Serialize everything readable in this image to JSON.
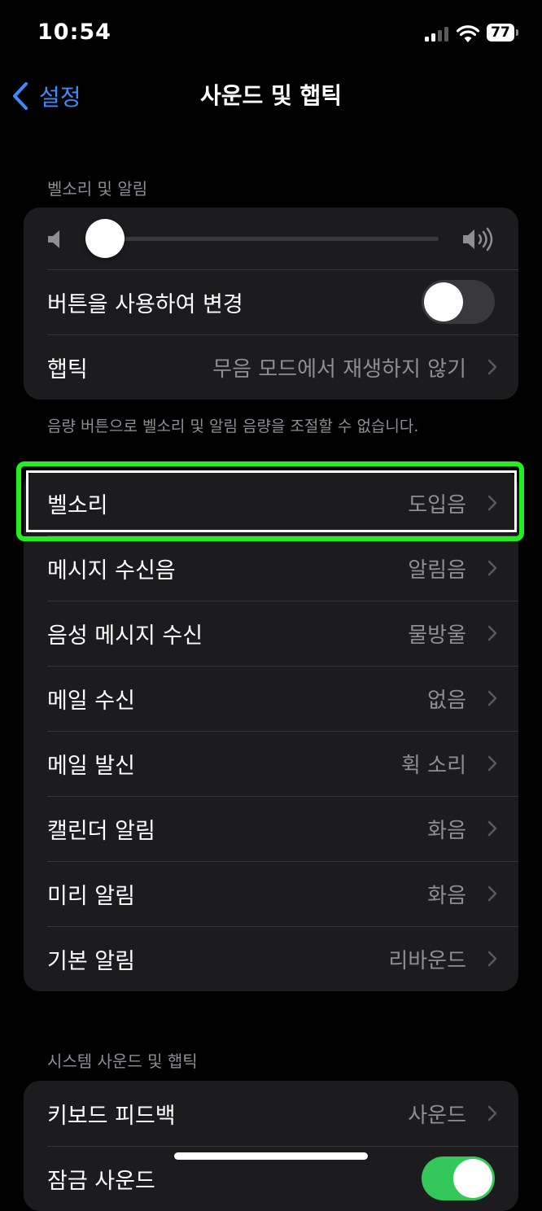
{
  "status": {
    "time": "10:54",
    "battery": "77"
  },
  "nav": {
    "back_label": "설정",
    "title": "사운드 및 햅틱"
  },
  "section1": {
    "header": "벨소리 및 알림",
    "volume_level": 0.0,
    "change_with_buttons": {
      "label": "버튼을 사용하여 변경",
      "on": false
    },
    "haptics": {
      "label": "햅틱",
      "value": "무음 모드에서 재생하지 않기"
    },
    "footer": "음량 버튼으로 벨소리 및 알림 음량을 조절할 수 없습니다."
  },
  "sounds": [
    {
      "label": "벨소리",
      "value": "도입음"
    },
    {
      "label": "메시지 수신음",
      "value": "알림음"
    },
    {
      "label": "음성 메시지 수신",
      "value": "물방울"
    },
    {
      "label": "메일 수신",
      "value": "없음"
    },
    {
      "label": "메일 발신",
      "value": "휙 소리"
    },
    {
      "label": "캘린더 알림",
      "value": "화음"
    },
    {
      "label": "미리 알림",
      "value": "화음"
    },
    {
      "label": "기본 알림",
      "value": "리바운드"
    }
  ],
  "section3": {
    "header": "시스템 사운드 및 햅틱",
    "keyboard_feedback": {
      "label": "키보드 피드백",
      "value": "사운드"
    },
    "lock_sound": {
      "label": "잠금 사운드",
      "on": true
    }
  },
  "colors": {
    "accent": "#3d8bfd",
    "highlight": "#22ee22",
    "toggle_on": "#34c759"
  }
}
